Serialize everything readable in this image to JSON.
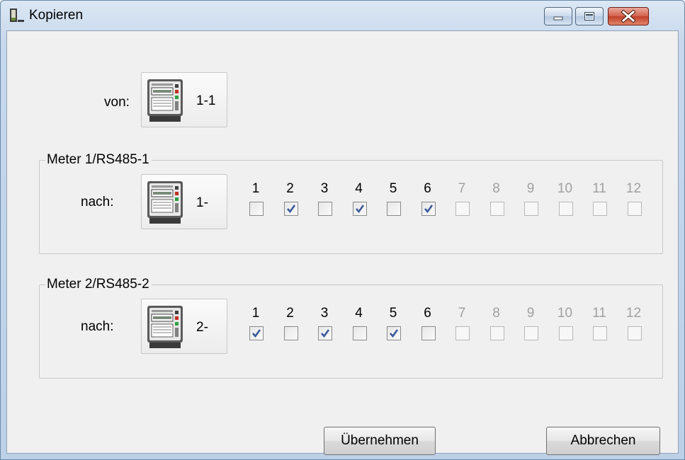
{
  "window": {
    "title": "Kopieren"
  },
  "source": {
    "label": "von:",
    "meter": "1-1"
  },
  "groups": [
    {
      "title": "Meter 1/RS485-1",
      "label": "nach:",
      "meter": "1-",
      "checkboxes": [
        {
          "n": "1",
          "checked": false,
          "enabled": true
        },
        {
          "n": "2",
          "checked": true,
          "enabled": true
        },
        {
          "n": "3",
          "checked": false,
          "enabled": true
        },
        {
          "n": "4",
          "checked": true,
          "enabled": true
        },
        {
          "n": "5",
          "checked": false,
          "enabled": true
        },
        {
          "n": "6",
          "checked": true,
          "enabled": true
        },
        {
          "n": "7",
          "checked": false,
          "enabled": false
        },
        {
          "n": "8",
          "checked": false,
          "enabled": false
        },
        {
          "n": "9",
          "checked": false,
          "enabled": false
        },
        {
          "n": "10",
          "checked": false,
          "enabled": false
        },
        {
          "n": "11",
          "checked": false,
          "enabled": false
        },
        {
          "n": "12",
          "checked": false,
          "enabled": false
        }
      ]
    },
    {
      "title": "Meter 2/RS485-2",
      "label": "nach:",
      "meter": "2-",
      "checkboxes": [
        {
          "n": "1",
          "checked": true,
          "enabled": true
        },
        {
          "n": "2",
          "checked": false,
          "enabled": true
        },
        {
          "n": "3",
          "checked": true,
          "enabled": true
        },
        {
          "n": "4",
          "checked": false,
          "enabled": true
        },
        {
          "n": "5",
          "checked": true,
          "enabled": true
        },
        {
          "n": "6",
          "checked": false,
          "enabled": true
        },
        {
          "n": "7",
          "checked": false,
          "enabled": false
        },
        {
          "n": "8",
          "checked": false,
          "enabled": false
        },
        {
          "n": "9",
          "checked": false,
          "enabled": false
        },
        {
          "n": "10",
          "checked": false,
          "enabled": false
        },
        {
          "n": "11",
          "checked": false,
          "enabled": false
        },
        {
          "n": "12",
          "checked": false,
          "enabled": false
        }
      ]
    }
  ],
  "buttons": {
    "apply": "Übernehmen",
    "cancel": "Abbrechen"
  },
  "icons": {
    "title": "window-app-icon",
    "meter": "electricity-meter-icon",
    "minimize": "minimize-icon",
    "maximize": "maximize-icon",
    "close": "close-icon"
  },
  "colors": {
    "check": "#3c5a9a",
    "disabled_text": "#a0a0a0"
  }
}
